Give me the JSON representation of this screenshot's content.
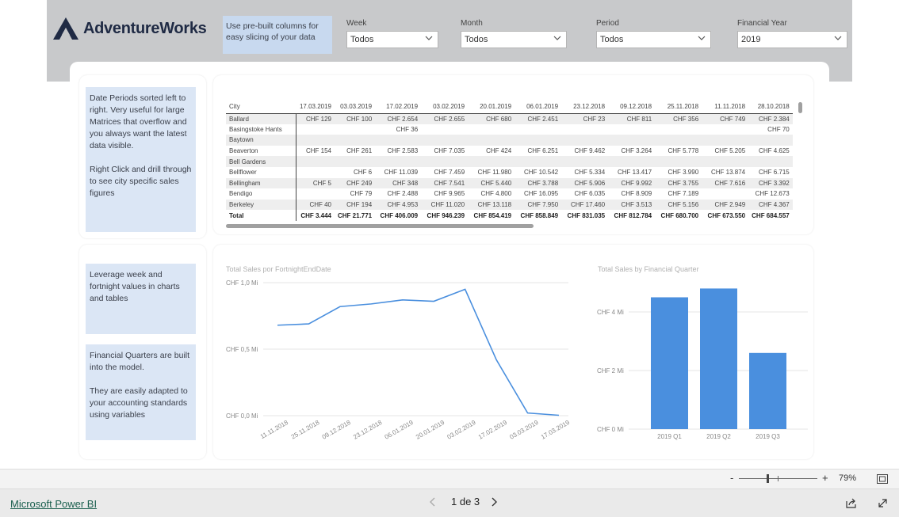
{
  "header": {
    "logo_text": "AdventureWorks",
    "hint": "Use pre-built columns for easy slicing of your data"
  },
  "slicers": [
    {
      "label": "Week",
      "value": "Todos"
    },
    {
      "label": "Month",
      "value": "Todos"
    },
    {
      "label": "Period",
      "value": "Todos"
    },
    {
      "label": "Financial Year",
      "value": "2019"
    }
  ],
  "notes": {
    "periods": "Date Periods sorted left to right. Very useful for large Matrices that overflow and you always want the latest data visible.\n\nRight Click and drill through to see city specific sales figures",
    "week": "Leverage week and fortnight values in charts and tables",
    "quarters": "Financial Quarters are built into the model.\n\nThey are easily adapted to your accounting standards using variables"
  },
  "matrix": {
    "columns": [
      "City",
      "17.03.2019",
      "03.03.2019",
      "17.02.2019",
      "03.02.2019",
      "20.01.2019",
      "06.01.2019",
      "23.12.2018",
      "09.12.2018",
      "25.11.2018",
      "11.11.2018",
      "28.10.2018"
    ],
    "rows": [
      [
        "Ballard",
        "CHF 129",
        "CHF 100",
        "CHF 2.654",
        "CHF 2.655",
        "CHF 680",
        "CHF 2.451",
        "CHF 23",
        "CHF 811",
        "CHF 356",
        "CHF 749",
        "CHF 2.384"
      ],
      [
        "Basingstoke Hants",
        "",
        "",
        "CHF 36",
        "",
        "",
        "",
        "",
        "",
        "",
        "",
        "CHF 70"
      ],
      [
        "Baytown",
        "",
        "",
        "",
        "",
        "",
        "",
        "",
        "",
        "",
        "",
        ""
      ],
      [
        "Beaverton",
        "CHF 154",
        "CHF 261",
        "CHF 2.583",
        "CHF 7.035",
        "CHF 424",
        "CHF 6.251",
        "CHF 9.462",
        "CHF 3.264",
        "CHF 5.778",
        "CHF 5.205",
        "CHF 4.625"
      ],
      [
        "Bell Gardens",
        "",
        "",
        "",
        "",
        "",
        "",
        "",
        "",
        "",
        "",
        ""
      ],
      [
        "Bellflower",
        "",
        "CHF 6",
        "CHF 11.039",
        "CHF 7.459",
        "CHF 11.980",
        "CHF 10.542",
        "CHF 5.334",
        "CHF 13.417",
        "CHF 3.990",
        "CHF 13.874",
        "CHF 6.715"
      ],
      [
        "Bellingham",
        "CHF 5",
        "CHF 249",
        "CHF 348",
        "CHF 7.541",
        "CHF 5.440",
        "CHF 3.788",
        "CHF 5.906",
        "CHF 9.992",
        "CHF 3.755",
        "CHF 7.616",
        "CHF 3.392"
      ],
      [
        "Bendigo",
        "",
        "CHF 79",
        "CHF 2.488",
        "CHF 9.965",
        "CHF 4.800",
        "CHF 16.095",
        "CHF 6.035",
        "CHF 8.909",
        "CHF 7.189",
        "",
        "CHF 12.673"
      ],
      [
        "Berkeley",
        "CHF 40",
        "CHF 194",
        "CHF 4.953",
        "CHF 11.020",
        "CHF 13.118",
        "CHF 7.950",
        "CHF 17.460",
        "CHF 3.513",
        "CHF 5.156",
        "CHF 2.949",
        "CHF 4.367"
      ]
    ],
    "total": [
      "Total",
      "CHF 3.444",
      "CHF 21.771",
      "CHF 406.009",
      "CHF 946.239",
      "CHF 854.419",
      "CHF 858.849",
      "CHF 831.035",
      "CHF 812.784",
      "CHF 680.700",
      "CHF 673.550",
      "CHF 684.557"
    ]
  },
  "chart_data": [
    {
      "type": "line",
      "title": "Total Sales por FortnightEndDate",
      "x": [
        "11.11.2018",
        "25.11.2018",
        "09.12.2018",
        "23.12.2018",
        "06.01.2019",
        "20.01.2019",
        "03.02.2019",
        "17.02.2019",
        "03.03.2019",
        "17.03.2019"
      ],
      "values": [
        0.68,
        0.69,
        0.82,
        0.84,
        0.87,
        0.86,
        0.95,
        0.42,
        0.02,
        0.003
      ],
      "yticks": [
        "CHF 0,0 Mi",
        "CHF 0,5 Mi",
        "CHF 1,0 Mi"
      ],
      "ylim": [
        0,
        1.0
      ],
      "color": "#4a8fde"
    },
    {
      "type": "bar",
      "title": "Total Sales by Financial Quarter",
      "categories": [
        "2019 Q1",
        "2019 Q2",
        "2019 Q3"
      ],
      "values": [
        4.5,
        4.8,
        2.6
      ],
      "yticks": [
        "CHF 0 Mi",
        "CHF 2 Mi",
        "CHF 4 Mi"
      ],
      "ylim": [
        0,
        4.0
      ],
      "color": "#4a8fde"
    }
  ],
  "zoom": {
    "minus": "-",
    "plus": "+",
    "level": "79%"
  },
  "footer": {
    "link": "Microsoft Power BI",
    "page": "1 de 3"
  }
}
